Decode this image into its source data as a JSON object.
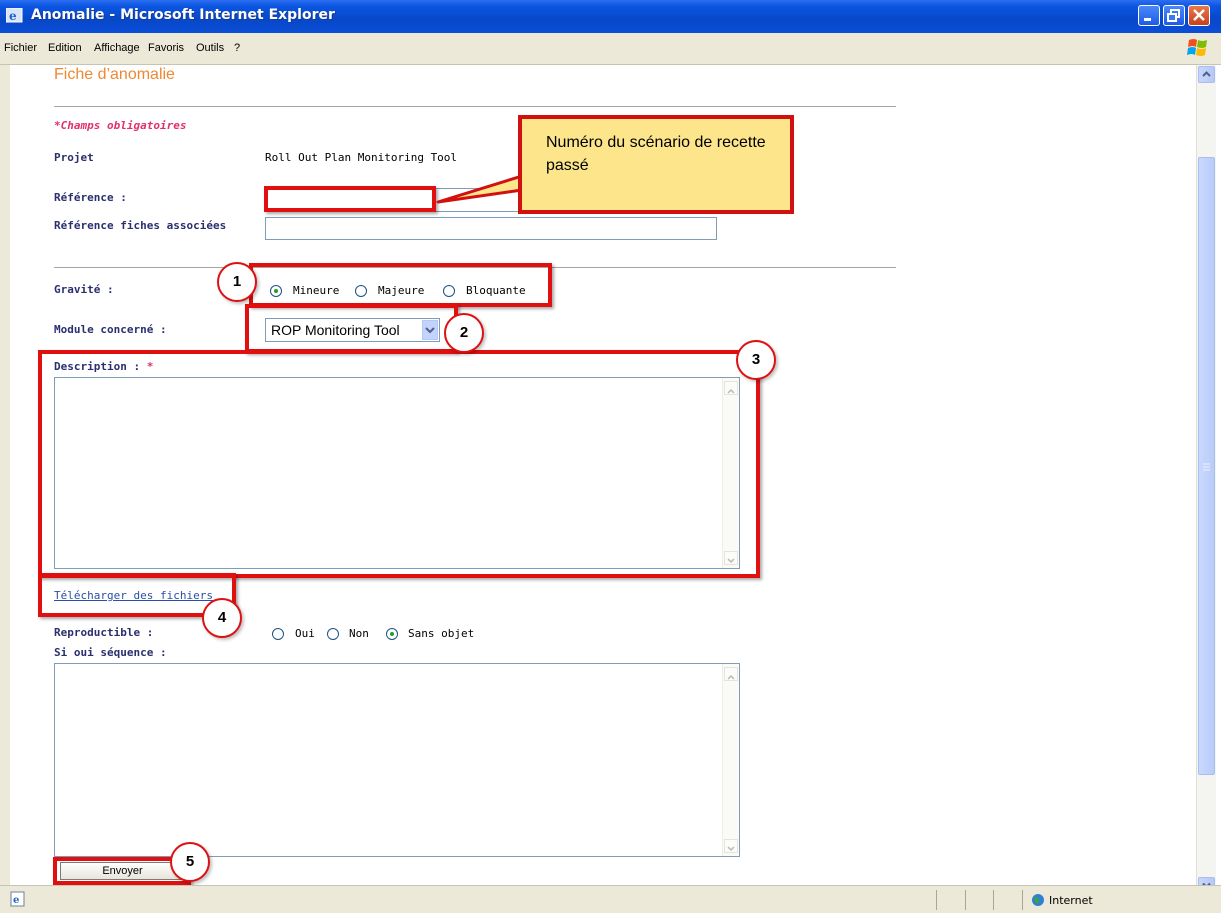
{
  "window": {
    "title": "Anomalie - Microsoft Internet Explorer",
    "menu": [
      "Fichier",
      "Edition",
      "Affichage",
      "Favoris",
      "Outils",
      "?"
    ]
  },
  "page": {
    "title": "Fiche d’anomalie",
    "required_note": "*Champs obligatoires"
  },
  "form": {
    "projet_label": "Projet",
    "projet_value": "Roll Out Plan Monitoring Tool",
    "reference_label": "Référence :",
    "reference_value": "",
    "ref_associees_label": "Référence fiches associées",
    "ref_associees_value": "",
    "gravite_label": "Gravité :",
    "gravite_options": [
      "Mineure",
      "Majeure",
      "Bloquante"
    ],
    "gravite_selected": "Mineure",
    "module_label": "Module concerné :",
    "module_value": "ROP Monitoring Tool",
    "description_label": "Description :",
    "description_required_mark": "*",
    "description_value": "",
    "upload_link": "Télécharger des fichiers",
    "reproductible_label": "Reproductible :",
    "reproductible_options": [
      "Oui",
      "Non",
      "Sans objet"
    ],
    "reproductible_selected": "Sans objet",
    "sequence_label": "Si oui séquence :",
    "sequence_value": "",
    "submit_label": "Envoyer"
  },
  "annotations": {
    "callout_text": "Numéro du scénario de recette passé",
    "markers": [
      "1",
      "2",
      "3",
      "4",
      "5"
    ]
  },
  "statusbar": {
    "zone": "Internet"
  },
  "colors": {
    "title_orange": "#ee8833",
    "required_pink": "#e0306a",
    "label_navy": "#2a2f6e",
    "annotation_red": "#e01010",
    "callout_yellow": "#fde58b"
  }
}
